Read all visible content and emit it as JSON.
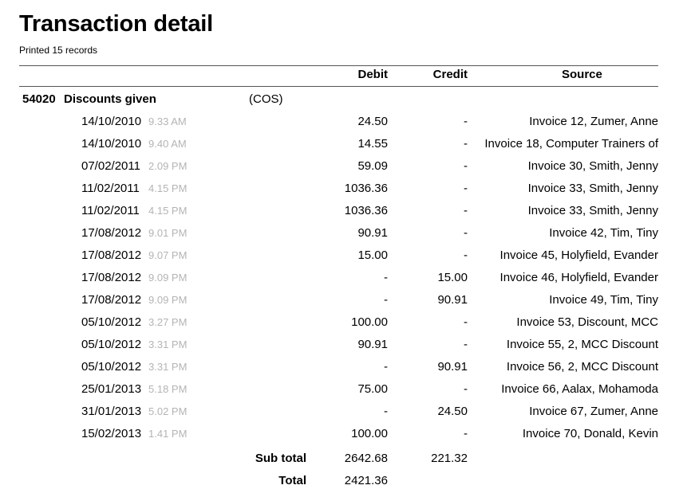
{
  "report": {
    "title": "Transaction detail",
    "printed": "Printed 15 records"
  },
  "columns": {
    "debit": "Debit",
    "credit": "Credit",
    "source": "Source"
  },
  "account": {
    "code": "54020",
    "name": "Discounts given",
    "type": "(COS)"
  },
  "rows": [
    {
      "date": "14/10/2010",
      "time": "9.33 AM",
      "debit": "24.50",
      "credit": "-",
      "source": "Invoice 12, Zumer, Anne"
    },
    {
      "date": "14/10/2010",
      "time": "9.40 AM",
      "debit": "14.55",
      "credit": "-",
      "source": "Invoice 18, Computer Trainers of"
    },
    {
      "date": "07/02/2011",
      "time": "2.09 PM",
      "debit": "59.09",
      "credit": "-",
      "source": "Invoice 30, Smith, Jenny"
    },
    {
      "date": "11/02/2011",
      "time": "4.15 PM",
      "debit": "1036.36",
      "credit": "-",
      "source": "Invoice 33, Smith, Jenny"
    },
    {
      "date": "11/02/2011",
      "time": "4.15 PM",
      "debit": "1036.36",
      "credit": "-",
      "source": "Invoice 33, Smith, Jenny"
    },
    {
      "date": "17/08/2012",
      "time": "9.01 PM",
      "debit": "90.91",
      "credit": "-",
      "source": "Invoice 42, Tim, Tiny"
    },
    {
      "date": "17/08/2012",
      "time": "9.07 PM",
      "debit": "15.00",
      "credit": "-",
      "source": "Invoice 45, Holyfield, Evander"
    },
    {
      "date": "17/08/2012",
      "time": "9.09 PM",
      "debit": "-",
      "credit": "15.00",
      "source": "Invoice 46, Holyfield, Evander"
    },
    {
      "date": "17/08/2012",
      "time": "9.09 PM",
      "debit": "-",
      "credit": "90.91",
      "source": "Invoice 49, Tim, Tiny"
    },
    {
      "date": "05/10/2012",
      "time": "3.27 PM",
      "debit": "100.00",
      "credit": "-",
      "source": "Invoice 53, Discount, MCC"
    },
    {
      "date": "05/10/2012",
      "time": "3.31 PM",
      "debit": "90.91",
      "credit": "-",
      "source": "Invoice 55, 2, MCC Discount"
    },
    {
      "date": "05/10/2012",
      "time": "3.31 PM",
      "debit": "-",
      "credit": "90.91",
      "source": "Invoice 56, 2, MCC Discount"
    },
    {
      "date": "25/01/2013",
      "time": "5.18 PM",
      "debit": "75.00",
      "credit": "-",
      "source": "Invoice 66, Aalax, Mohamoda"
    },
    {
      "date": "31/01/2013",
      "time": "5.02 PM",
      "debit": "-",
      "credit": "24.50",
      "source": "Invoice 67, Zumer, Anne"
    },
    {
      "date": "15/02/2013",
      "time": "1.41 PM",
      "debit": "100.00",
      "credit": "-",
      "source": "Invoice 70, Donald, Kevin"
    }
  ],
  "subtotal": {
    "label": "Sub total",
    "debit": "2642.68",
    "credit": "221.32"
  },
  "total": {
    "label": "Total",
    "debit": "2421.36"
  }
}
